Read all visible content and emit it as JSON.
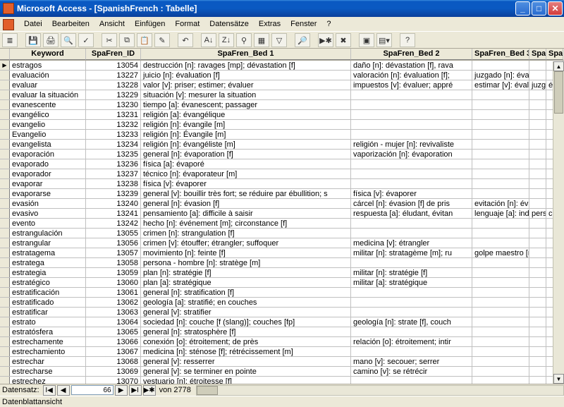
{
  "title": "Microsoft Access - [SpanishFrench : Tabelle]",
  "menus": [
    "Datei",
    "Bearbeiten",
    "Ansicht",
    "Einfügen",
    "Format",
    "Datensätze",
    "Extras",
    "Fenster",
    "?"
  ],
  "columns": [
    "Keyword",
    "SpaFren_ID",
    "SpaFren_Bed 1",
    "SpaFren_Bed 2",
    "SpaFren_Bed 3",
    "SpaFren_Bed",
    "SpaFre"
  ],
  "rows": [
    {
      "sel": "▶",
      "kw": "estragos",
      "id": "13054",
      "b1": "destrucción [n]: ravages [mp]; dévastation [f]",
      "b2": "daño [n]: dévastation [f], rava",
      "b3": "",
      "b4": "",
      "b5": ""
    },
    {
      "sel": "",
      "kw": "evaluación",
      "id": "13227",
      "b1": "juicio [n]: évaluation [f]",
      "b2": "valoración [n]: évaluation [f]; ",
      "b3": "juzgado [n]: évaluation",
      "b4": "",
      "b5": ""
    },
    {
      "sel": "",
      "kw": "evaluar",
      "id": "13228",
      "b1": "valor [v]: priser; estimer; évaluer",
      "b2": "impuestos [v]: évaluer; appré",
      "b3": "estimar [v]: évaluer, es",
      "b4": "juzgar [v]:",
      "b5": "évalu"
    },
    {
      "sel": "",
      "kw": "evaluar la situación",
      "id": "13229",
      "b1": "situación [v]: mesurer la situation",
      "b2": "",
      "b3": "",
      "b4": "",
      "b5": ""
    },
    {
      "sel": "",
      "kw": "evanescente",
      "id": "13230",
      "b1": "tiempo [a]: évanescent; passager",
      "b2": "",
      "b3": "",
      "b4": "",
      "b5": ""
    },
    {
      "sel": "",
      "kw": "evangélico",
      "id": "13231",
      "b1": "religión [a]: évangélique",
      "b2": "",
      "b3": "",
      "b4": "",
      "b5": ""
    },
    {
      "sel": "",
      "kw": "evangelio",
      "id": "13232",
      "b1": "religión [n]: évangile [m]",
      "b2": "",
      "b3": "",
      "b4": "",
      "b5": ""
    },
    {
      "sel": "",
      "kw": "Evangelio",
      "id": "13233",
      "b1": "religión [n]: Évangile [m]",
      "b2": "",
      "b3": "",
      "b4": "",
      "b5": ""
    },
    {
      "sel": "",
      "kw": "evangelista",
      "id": "13234",
      "b1": "religión [n]: évangéliste [m]",
      "b2": "religión - mujer [n]: revivaliste",
      "b3": "",
      "b4": "",
      "b5": ""
    },
    {
      "sel": "",
      "kw": "evaporación",
      "id": "13235",
      "b1": "general [n]: évaporation [f]",
      "b2": "vaporización [n]: évaporation",
      "b3": "",
      "b4": "",
      "b5": ""
    },
    {
      "sel": "",
      "kw": "evaporado",
      "id": "13236",
      "b1": "física [a]: évaporé",
      "b2": "",
      "b3": "",
      "b4": "",
      "b5": ""
    },
    {
      "sel": "",
      "kw": "evaporador",
      "id": "13237",
      "b1": "técnico [n]: évaporateur [m]",
      "b2": "",
      "b3": "",
      "b4": "",
      "b5": ""
    },
    {
      "sel": "",
      "kw": "evaporar",
      "id": "13238",
      "b1": "física [v]: évaporer",
      "b2": "",
      "b3": "",
      "b4": "",
      "b5": ""
    },
    {
      "sel": "",
      "kw": "evaporarse",
      "id": "13239",
      "b1": "general [v]: bouillir très fort; se réduire par ébullition; s",
      "b2": "física [v]: évaporer",
      "b3": "",
      "b4": "",
      "b5": ""
    },
    {
      "sel": "",
      "kw": "evasión",
      "id": "13240",
      "b1": "general [n]: évasion [f]",
      "b2": "cárcel [n]: évasion [f] de pris",
      "b3": "evitación [n]: évasion [f",
      "b4": "",
      "b5": ""
    },
    {
      "sel": "",
      "kw": "evasivo",
      "id": "13241",
      "b1": "pensamiento [a]: difficile à saisir",
      "b2": "respuesta [a]: éludant, évitan",
      "b3": "lenguaje [a]: indirect, v",
      "b4": "persona [a]: ins",
      "b5": "compor"
    },
    {
      "sel": "",
      "kw": "evento",
      "id": "13242",
      "b1": "hecho [n]: événement [m]; circonstance [f]",
      "b2": "",
      "b3": "",
      "b4": "",
      "b5": ""
    },
    {
      "sel": "",
      "kw": "estrangulación",
      "id": "13055",
      "b1": "crimen [n]: strangulation [f]",
      "b2": "",
      "b3": "",
      "b4": "",
      "b5": ""
    },
    {
      "sel": "",
      "kw": "estrangular",
      "id": "13056",
      "b1": "crimen [v]: étouffer; étrangler; suffoquer",
      "b2": "medicina [v]: étrangler",
      "b3": "",
      "b4": "",
      "b5": ""
    },
    {
      "sel": "",
      "kw": "estratagema",
      "id": "13057",
      "b1": "movimiento [n]: feinte [f]",
      "b2": "militar [n]: stratagème [m]; ru",
      "b3": "golpe maestro [n]: cou",
      "b4": "",
      "b5": ""
    },
    {
      "sel": "",
      "kw": "estratega",
      "id": "13058",
      "b1": "persona - hombre [n]: stratège [m]",
      "b2": "",
      "b3": "",
      "b4": "",
      "b5": ""
    },
    {
      "sel": "",
      "kw": "estrategia",
      "id": "13059",
      "b1": "plan [n]: stratégie [f]",
      "b2": "militar [n]: stratégie [f]",
      "b3": "",
      "b4": "",
      "b5": ""
    },
    {
      "sel": "",
      "kw": "estratégico",
      "id": "13060",
      "b1": "plan [a]: stratégique",
      "b2": "militar [a]: stratégique",
      "b3": "",
      "b4": "",
      "b5": ""
    },
    {
      "sel": "",
      "kw": "estratificación",
      "id": "13061",
      "b1": "general [n]: stratification [f]",
      "b2": "",
      "b3": "",
      "b4": "",
      "b5": ""
    },
    {
      "sel": "",
      "kw": "estratificado",
      "id": "13062",
      "b1": "geología [a]: stratifié; en couches",
      "b2": "",
      "b3": "",
      "b4": "",
      "b5": ""
    },
    {
      "sel": "",
      "kw": "estratificar",
      "id": "13063",
      "b1": "general [v]: stratifier",
      "b2": "",
      "b3": "",
      "b4": "",
      "b5": ""
    },
    {
      "sel": "",
      "kw": "estrato",
      "id": "13064",
      "b1": "sociedad [n]: couche [f (slang)]; couches [fp]",
      "b2": "geología [n]: strate [f], couch",
      "b3": "",
      "b4": "",
      "b5": ""
    },
    {
      "sel": "",
      "kw": "estratósfera",
      "id": "13065",
      "b1": "general [n]: stratosphère [f]",
      "b2": "",
      "b3": "",
      "b4": "",
      "b5": ""
    },
    {
      "sel": "",
      "kw": "estrechamente",
      "id": "13066",
      "b1": "conexión [o]: étroitement; de près",
      "b2": "relación [o]: étroitement; intir",
      "b3": "",
      "b4": "",
      "b5": ""
    },
    {
      "sel": "",
      "kw": "estrechamiento",
      "id": "13067",
      "b1": "medicina [n]: sténose [f]; rétrécissement [m]",
      "b2": "",
      "b3": "",
      "b4": "",
      "b5": ""
    },
    {
      "sel": "",
      "kw": "estrechar",
      "id": "13068",
      "b1": "general [v]: resserrer",
      "b2": "mano [v]: secouer; serrer",
      "b3": "",
      "b4": "",
      "b5": ""
    },
    {
      "sel": "",
      "kw": "estrecharse",
      "id": "13069",
      "b1": "general [v]: se terminer en pointe",
      "b2": "camino [v]: se rétrécir",
      "b3": "",
      "b4": "",
      "b5": ""
    },
    {
      "sel": "",
      "kw": "estrechez",
      "id": "13070",
      "b1": "vestuario [n]: étroitesse [f]",
      "b2": "",
      "b3": "",
      "b4": "",
      "b5": ""
    }
  ],
  "recnav": {
    "label": "Datensatz:",
    "current": "66",
    "total": "von  2778"
  },
  "status": "Datenblattansicht"
}
